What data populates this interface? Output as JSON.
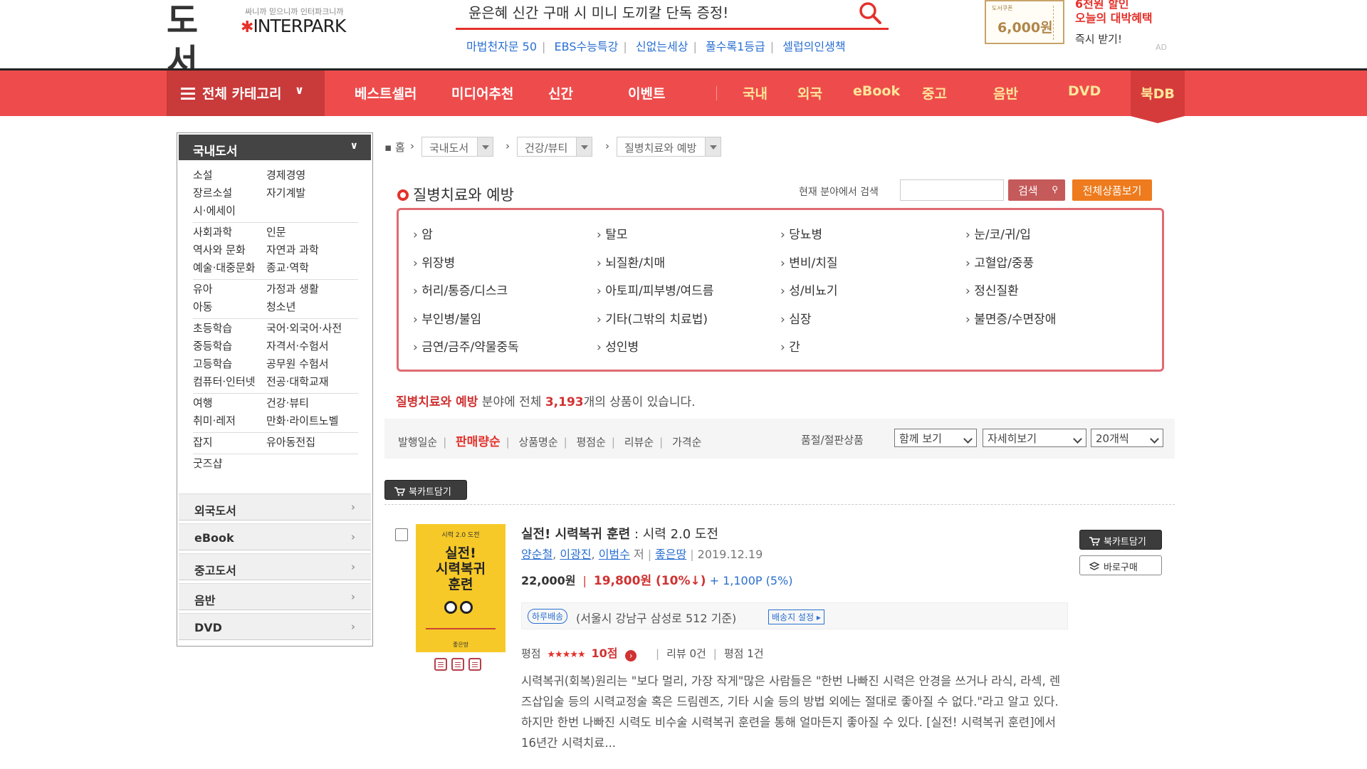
{
  "header": {
    "logo_main": "도서",
    "logo_tagline": "싸니까 믿으니까 인터파크니까",
    "logo_brand": "INTERPARK",
    "search_text": "윤은혜 신간 구매 시 미니 도끼칼 단독 증정!",
    "quicklinks": [
      "마법천자문 50",
      "EBS수능특강",
      "신없는세상",
      "풀수록1등급",
      "셀럽의인생책"
    ]
  },
  "ad": {
    "coupon_small": "도서쿠폰",
    "coupon_amount": "6,000원",
    "title_line1": "6천원 할인",
    "title_line2": "오늘의 대박혜택",
    "claim": "즉시 받기!",
    "label": "AD"
  },
  "nav": {
    "all_category": "전체 카테고리",
    "items": [
      "베스트셀러",
      "미디어추천",
      "신간",
      "이벤트"
    ],
    "sections": [
      "국내",
      "외국",
      "eBook",
      "중고",
      "음반",
      "DVD"
    ],
    "bookdb": "북DB"
  },
  "sidebar": {
    "header": "국내도서",
    "groups": [
      [
        "소설",
        "경제경영",
        "장르소설",
        "자기계발",
        "시·에세이"
      ],
      [
        "사회과학",
        "인문",
        "역사와 문화",
        "자연과 과학",
        "예술·대중문화",
        "종교·역학"
      ],
      [
        "유아",
        "가정과 생활",
        "아동",
        "청소년"
      ],
      [
        "초등학습",
        "국어·외국어·사전",
        "중등학습",
        "자격서·수험서",
        "고등학습",
        "공무원 수험서",
        "컴퓨터·인터넷",
        "전공·대학교재"
      ],
      [
        "여행",
        "건강·뷰티",
        "취미·레저",
        "만화·라이트노벨"
      ],
      [
        "잡지",
        "유아동전집"
      ],
      [
        "굿즈샵"
      ]
    ],
    "bottom": [
      "외국도서",
      "eBook",
      "중고도서",
      "음반",
      "DVD"
    ]
  },
  "breadcrumb": {
    "home": "홈",
    "levels": [
      "국내도서",
      "건강/뷰티",
      "질병치료와 예방"
    ]
  },
  "category": {
    "title": "질병치료와 예방",
    "search_label": "현재 분야에서 검색",
    "search_value": "",
    "search_button": "검색",
    "view_all_button": "전체상품보기",
    "subcategories": [
      "암",
      "탈모",
      "당뇨병",
      "눈/코/귀/입",
      "위장병",
      "뇌질환/치매",
      "변비/치질",
      "고혈압/중풍",
      "허리/통증/디스크",
      "아토피/피부병/여드름",
      "성/비뇨기",
      "정신질환",
      "부인병/불임",
      "기타(그밖의 치료법)",
      "심장",
      "불면증/수면장애",
      "금연/금주/약물중독",
      "성인병",
      "간"
    ]
  },
  "count": {
    "field": "질병치료와 예방",
    "text1": " 분야에 전체 ",
    "number": "3,193",
    "text2": "개의 상품이 있습니다."
  },
  "sort": {
    "options": [
      "발행일순",
      "판매량순",
      "상품명순",
      "평점순",
      "리뷰순",
      "가격순"
    ],
    "active": "판매량순",
    "status_filter": "품절/절판상품",
    "view_mode": "함께 보기",
    "detail_mode": "자세히보기",
    "per_page": "20개씩"
  },
  "cart_button": "북카트담기",
  "product": {
    "title": "실전! 시력복귀 훈련",
    "subtitle": " : 시력 2.0 도전",
    "authors": [
      "양순철",
      "이광진",
      "이범수"
    ],
    "author_suffix": "저",
    "publisher": "좋은땅",
    "date": "2019.12.19",
    "list_price": "22,000원",
    "sale_price": "19,800원 (10%↓)",
    "points": "+ 1,100P (5%)",
    "delivery_badge": "하루배송",
    "delivery_text": "(서울시 강남구 삼성로 512 기준)",
    "delivery_button": "배송지 설정",
    "rating_label": "평점",
    "stars": "★★★★★",
    "score": "10점",
    "reviews": "리뷰 0건",
    "ratings": "평점 1건",
    "description": "시력복귀(회복)원리는 \"보다 멀리, 가장 작게\"많은 사람들은 \"한번 나빠진 시력은 안경을 쓰거나 라식, 라섹, 렌즈삽입술 등의 시력교정술 혹은 드림렌즈, 기타 시술 등의 방법 외에는 절대로 좋아질 수 없다.\"라고 알고 있다. 하지만 한번 나빠진 시력도 비수술 시력복귀 훈련을 통해 얼마든지 좋아질 수 있다. [실전! 시력복귀 훈련]에서 16년간 시력치료...",
    "cart_button": "북카트담기",
    "buy_button": "바로구매",
    "cover": {
      "subtitle": "시력 2.0 도전",
      "title_line1": "실전!",
      "title_line2": "시력복귀",
      "title_line3": "훈련",
      "footer": "좋은땅"
    }
  },
  "colors": {
    "brand_red": "#ee4c4c",
    "accent_red": "#e4312b",
    "link_blue": "#2a6fd1",
    "orange": "#ee7b1e"
  }
}
